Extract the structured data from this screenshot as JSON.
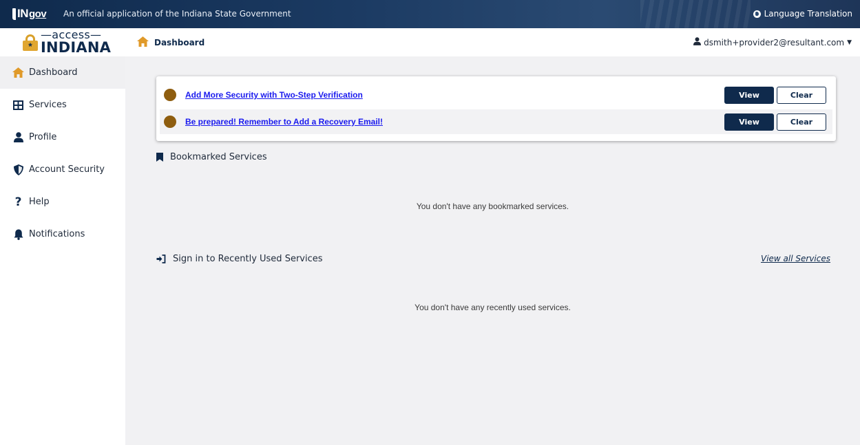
{
  "gov_banner": {
    "logo_in": "IN",
    "logo_gov": "gov",
    "text": "An official application of the Indiana State Government",
    "language_label": "Language Translation"
  },
  "brand": {
    "access": "—access—",
    "indiana": "INDIANA"
  },
  "sidebar": {
    "items": [
      {
        "label": "Dashboard",
        "icon": "home-icon",
        "active": true
      },
      {
        "label": "Services",
        "icon": "grid-icon"
      },
      {
        "label": "Profile",
        "icon": "person-icon"
      },
      {
        "label": "Account Security",
        "icon": "shield-icon"
      },
      {
        "label": "Help",
        "icon": "question-icon"
      },
      {
        "label": "Notifications",
        "icon": "bell-icon"
      }
    ]
  },
  "header": {
    "breadcrumb": "Dashboard",
    "user_email": "dsmith+provider2@resultant.com"
  },
  "alerts": [
    {
      "text": "Add More Security with Two-Step Verification",
      "view_label": "View",
      "clear_label": "Clear"
    },
    {
      "text": "Be prepared! Remember to Add a Recovery Email!",
      "view_label": "View",
      "clear_label": "Clear"
    }
  ],
  "bookmarks": {
    "title": "Bookmarked Services",
    "empty_text": "You don't have any bookmarked services."
  },
  "recent": {
    "title": "Sign in to Recently Used Services",
    "view_all_label": "View all Services",
    "empty_text": "You don't have any recently used services."
  },
  "colors": {
    "navy": "#0f2a4c",
    "accent_orange": "#e0a630",
    "alert_dot": "#8e5d0f",
    "link_blue": "#1a1aee",
    "main_bg": "#f1f1f3"
  }
}
